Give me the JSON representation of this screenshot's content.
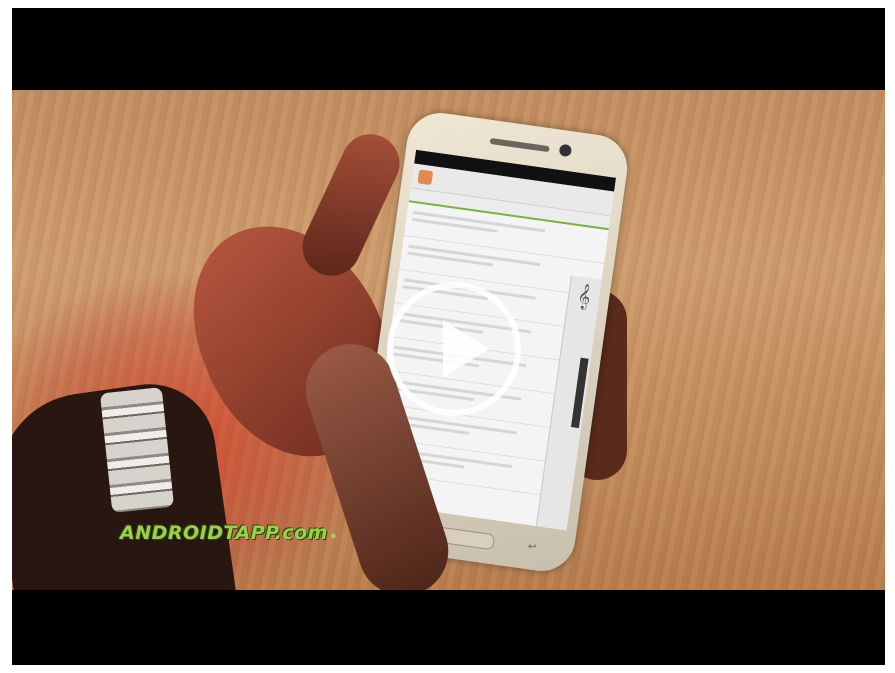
{
  "video": {
    "watermark_text": "ANDROIDTAPP.com",
    "watermark_icon": "android-icon",
    "play_icon": "play-icon",
    "colors": {
      "watermark": "#9bd04a",
      "letterbox": "#000000",
      "play_button": "#ffffff"
    }
  }
}
